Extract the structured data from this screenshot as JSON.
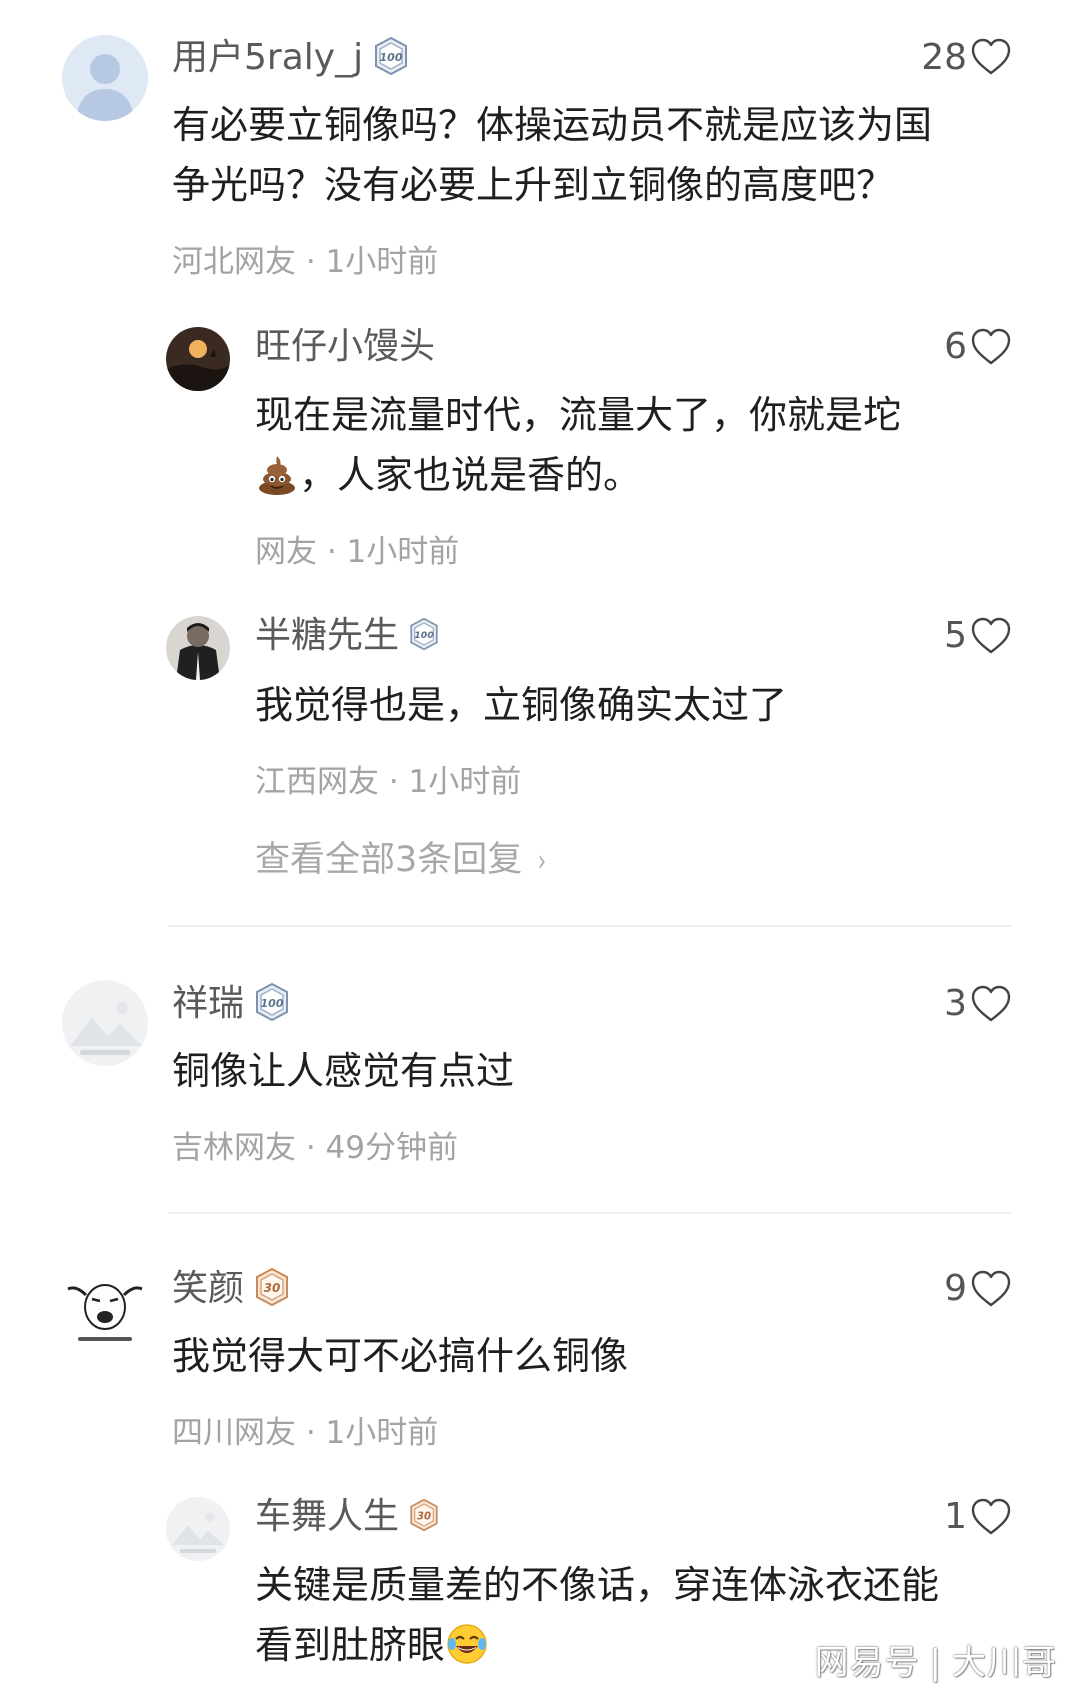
{
  "comments": [
    {
      "user": "用户5raly_j",
      "badge": "100",
      "likes": "28",
      "lines": [
        "有必要立铜像吗？体操运动员不就是应该为国",
        "争光吗？没有必要上升到立铜像的高度吧？"
      ],
      "meta": "河北网友 · 1小时前"
    },
    {
      "user": "旺仔小馒头",
      "likes": "6",
      "lines": [
        "现在是流量时代，流量大了，你就是坨",
        "，人家也说是香的。"
      ],
      "meta": "网友 · 1小时前"
    },
    {
      "user": "半糖先生",
      "badge": "100",
      "likes": "5",
      "lines": [
        "我觉得也是，立铜像确实太过了"
      ],
      "meta": "江西网友 · 1小时前"
    },
    {
      "user": "祥瑞",
      "badge": "100",
      "likes": "3",
      "lines": [
        "铜像让人感觉有点过"
      ],
      "meta": "吉林网友 · 49分钟前"
    },
    {
      "user": "笑颜",
      "badge": "30",
      "likes": "9",
      "lines": [
        "我觉得大可不必搞什么铜像"
      ],
      "meta": "四川网友 · 1小时前"
    },
    {
      "user": "车舞人生",
      "badge": "30",
      "likes": "1",
      "lines": [
        "关键是质量差的不像话，穿连体泳衣还能",
        "看到肚脐眼"
      ]
    }
  ],
  "view_replies": "查看全部3条回复",
  "emojis": [
    "poop-emoji",
    "laughing-tears-emoji"
  ],
  "icons": [
    "heart-outline-icon",
    "level-badge-icon",
    "chevron-right-icon"
  ],
  "colors": {
    "badge_100": "#7d93ad",
    "badge_30": "#c98a5a",
    "meta_text": "#a3a3a3",
    "name_text": "#5a5a5a"
  },
  "watermark": {
    "source": "网易号",
    "author": "大川哥"
  }
}
